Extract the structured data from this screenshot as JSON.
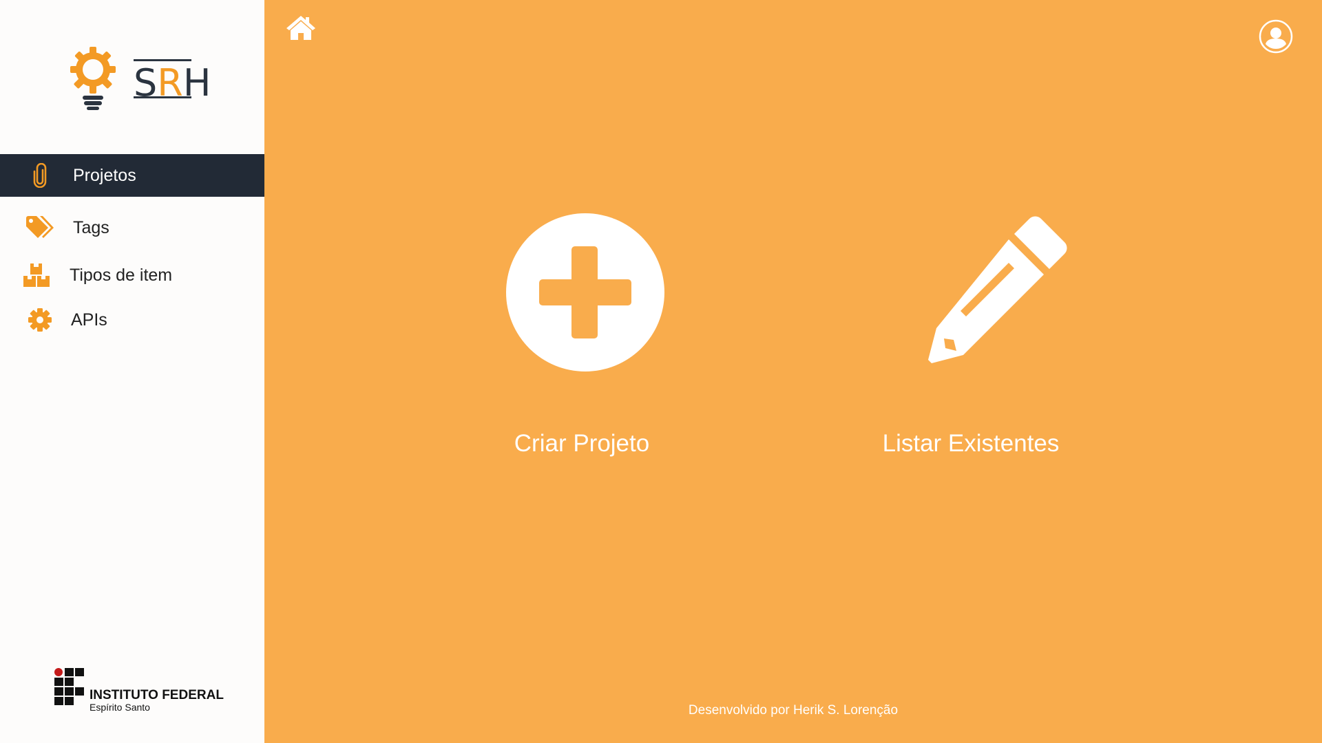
{
  "app": {
    "logo_text_s": "S",
    "logo_text_r": "R",
    "logo_text_h": "H"
  },
  "sidebar": {
    "items": [
      {
        "label": "Projetos",
        "icon": "paperclip-icon",
        "active": true
      },
      {
        "label": "Tags",
        "icon": "tags-icon",
        "active": false
      },
      {
        "label": "Tipos de item",
        "icon": "boxes-icon",
        "active": false
      },
      {
        "label": "APIs",
        "icon": "gear-icon",
        "active": false
      }
    ],
    "institution": {
      "name": "INSTITUTO FEDERAL",
      "campus": "Espírito Santo"
    }
  },
  "topbar": {
    "home_icon": "home-icon",
    "user_icon": "user-circle-icon"
  },
  "main": {
    "actions": [
      {
        "label": "Criar Projeto",
        "icon": "plus-circle-icon"
      },
      {
        "label": "Listar Existentes",
        "icon": "pencil-icon"
      }
    ],
    "footer": "Desenvolvido por Herik S. Lorenção"
  },
  "colors": {
    "accent": "#f9ac4c",
    "sidebar_bg": "#fdfcfb",
    "active_bg": "#222a36",
    "icon_orange": "#f39a24"
  }
}
